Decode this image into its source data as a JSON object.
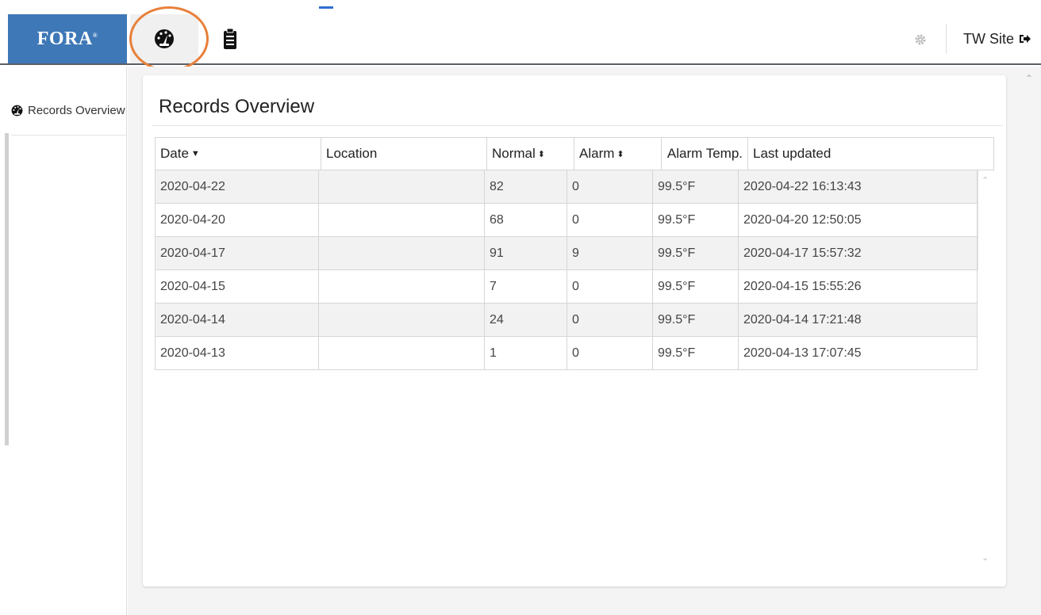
{
  "brand": {
    "name": "FORA",
    "mark": "®"
  },
  "nav": {
    "tabs": [
      {
        "icon": "dashboard-icon",
        "active": true
      },
      {
        "icon": "clipboard-icon",
        "active": false
      }
    ],
    "site_label": "TW Site"
  },
  "sidebar": {
    "items": [
      {
        "label": "Records Overview",
        "icon": "dashboard-icon"
      }
    ]
  },
  "main": {
    "title": "Records Overview",
    "table": {
      "columns": [
        {
          "label": "Date",
          "sort": "desc"
        },
        {
          "label": "Location",
          "sort": ""
        },
        {
          "label": "Normal",
          "sort": "both"
        },
        {
          "label": "Alarm",
          "sort": "both"
        },
        {
          "label": "Alarm Temp.",
          "sort": ""
        },
        {
          "label": "Last updated",
          "sort": ""
        }
      ],
      "rows": [
        [
          "2020-04-22",
          "",
          "82",
          "0",
          "99.5°F",
          "2020-04-22 16:13:43"
        ],
        [
          "2020-04-20",
          "",
          "68",
          "0",
          "99.5°F",
          "2020-04-20 12:50:05"
        ],
        [
          "2020-04-17",
          "",
          "91",
          "9",
          "99.5°F",
          "2020-04-17 15:57:32"
        ],
        [
          "2020-04-15",
          "",
          "7",
          "0",
          "99.5°F",
          "2020-04-15 15:55:26"
        ],
        [
          "2020-04-14",
          "",
          "24",
          "0",
          "99.5°F",
          "2020-04-14 17:21:48"
        ],
        [
          "2020-04-13",
          "",
          "1",
          "0",
          "99.5°F",
          "2020-04-13 17:07:45"
        ]
      ]
    }
  },
  "colors": {
    "brand": "#3e78b7",
    "highlight": "#e8803a"
  }
}
